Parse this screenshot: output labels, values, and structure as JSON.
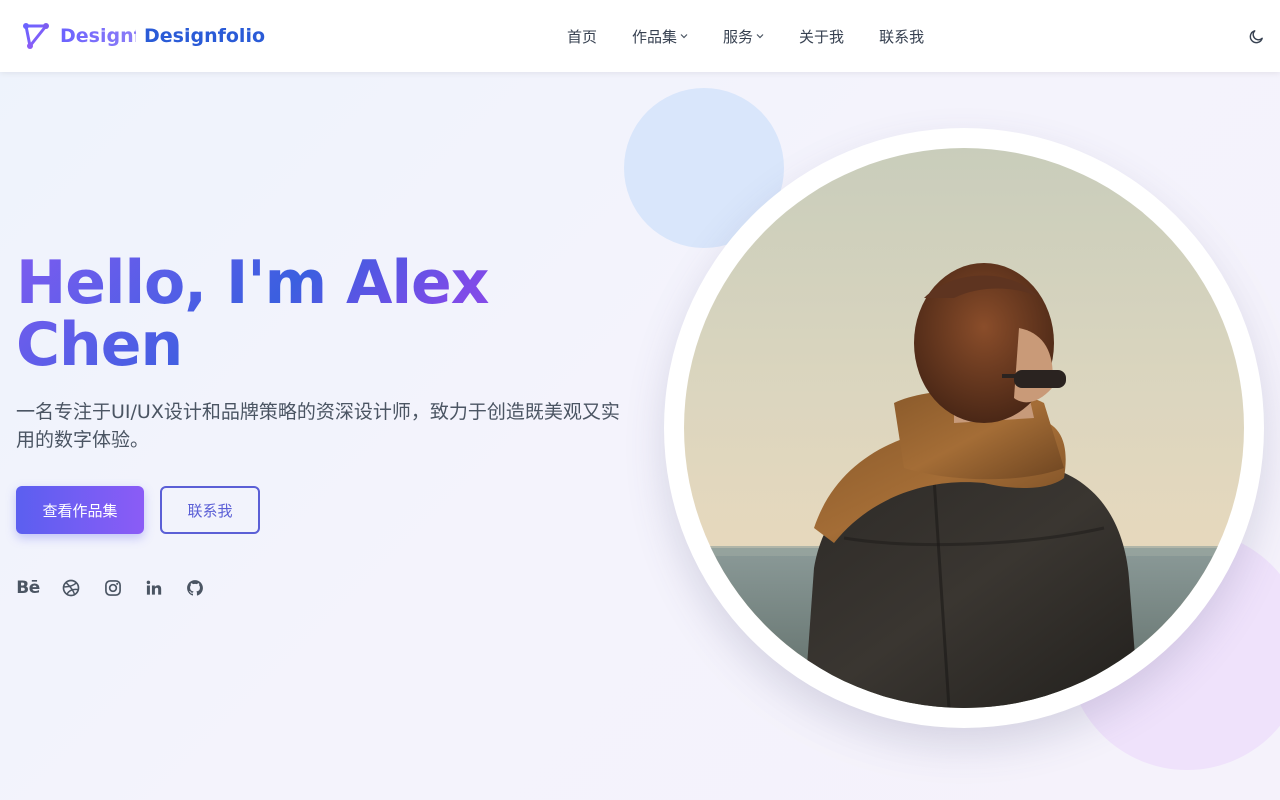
{
  "brand": {
    "logo_faded": "Designfolio",
    "name": "Designfolio"
  },
  "nav": {
    "items": [
      {
        "label": "首页",
        "dropdown": false
      },
      {
        "label": "作品集",
        "dropdown": true
      },
      {
        "label": "服务",
        "dropdown": true
      },
      {
        "label": "关于我",
        "dropdown": false
      },
      {
        "label": "联系我",
        "dropdown": false
      }
    ],
    "theme_toggle": "moon-icon"
  },
  "hero": {
    "title": "Hello, I'm Alex Chen",
    "subtitle": "一名专注于UI/UX设计和品牌策略的资深设计师，致力于创造既美观又实用的数字体验。",
    "primary_button": "查看作品集",
    "secondary_button": "联系我",
    "socials": [
      {
        "icon": "behance-icon",
        "text": "Bē"
      },
      {
        "icon": "dribbble-icon"
      },
      {
        "icon": "instagram-icon"
      },
      {
        "icon": "linkedin-icon"
      },
      {
        "icon": "github-icon"
      }
    ]
  },
  "colors": {
    "brand_blue": "#2a5bd7",
    "accent_purple": "#8b5cf6",
    "accent_indigo": "#5b5fd6"
  }
}
